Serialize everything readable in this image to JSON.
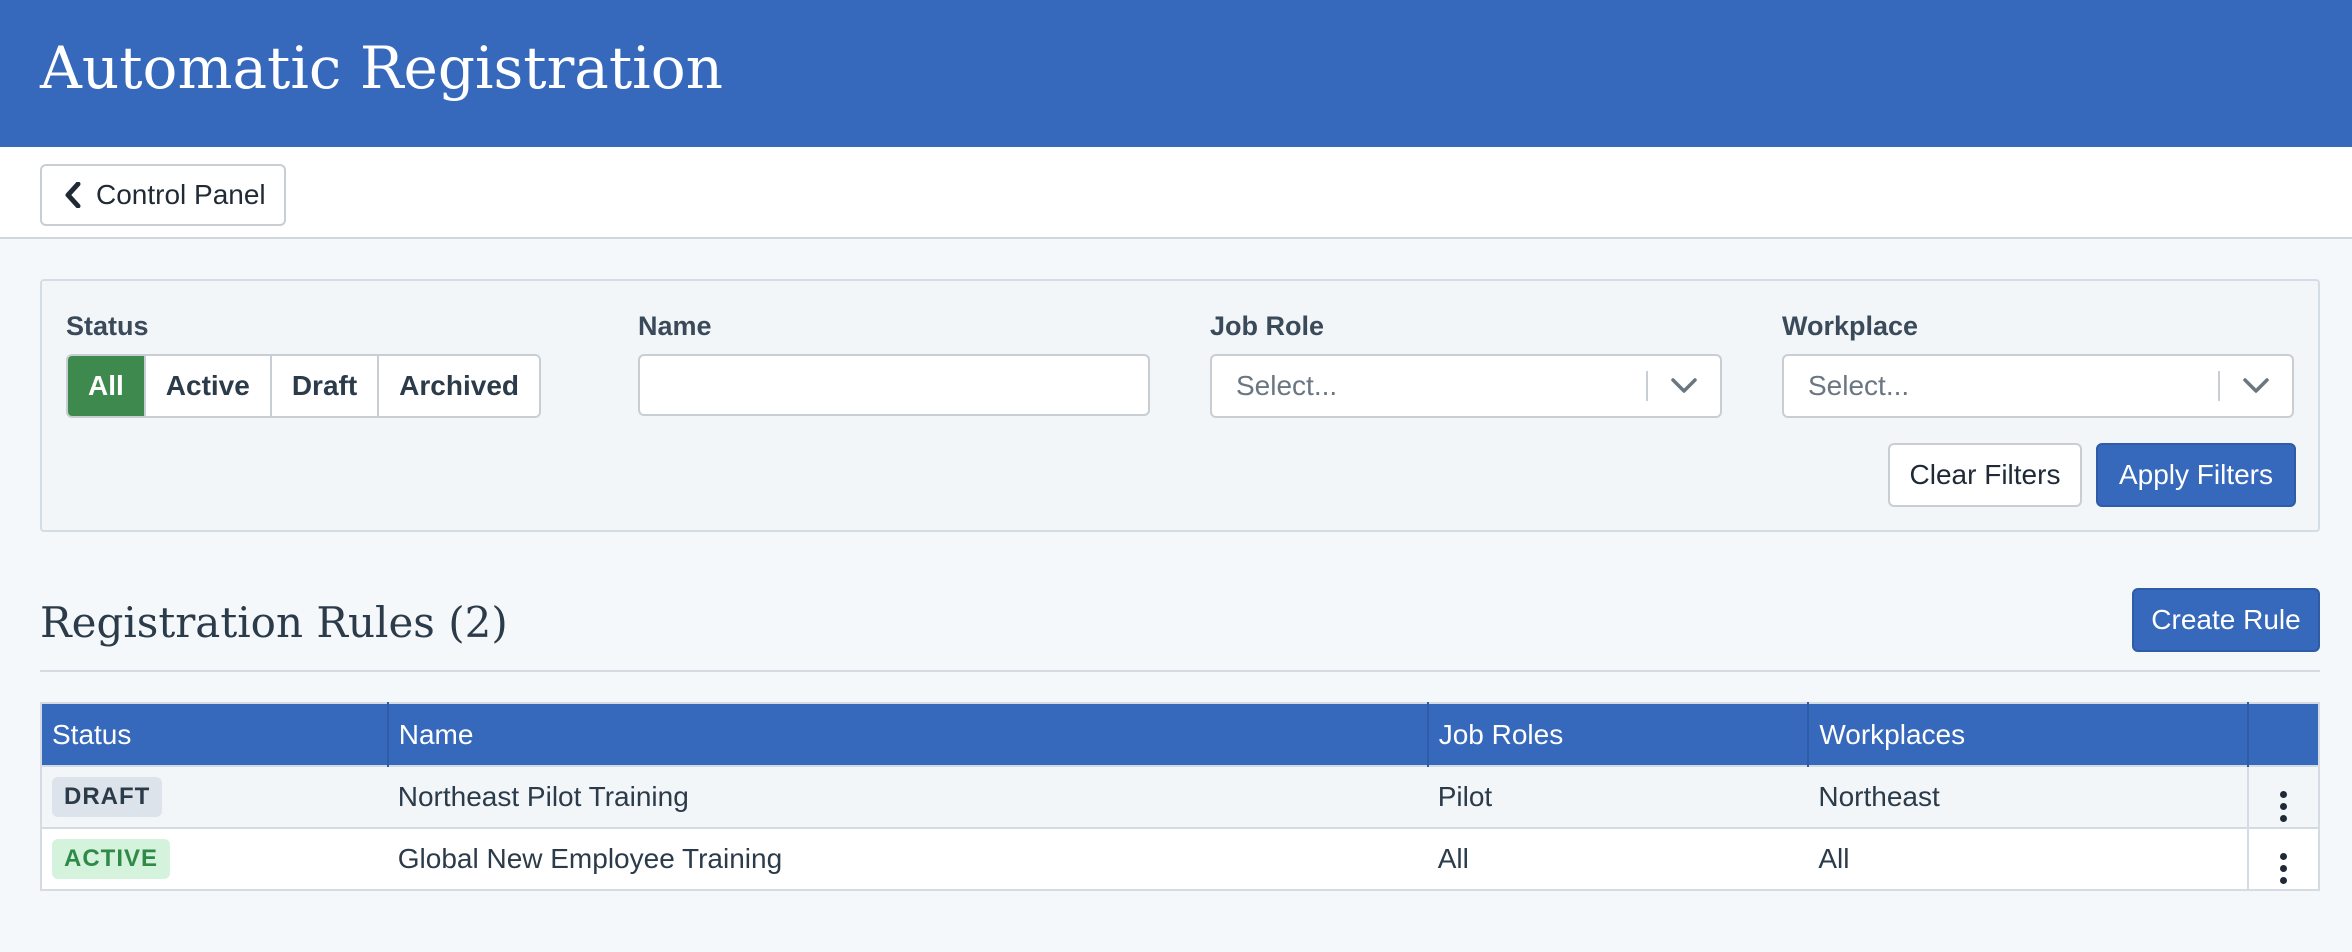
{
  "header": {
    "title": "Automatic Registration"
  },
  "topbar": {
    "back_label": "Control Panel"
  },
  "filters": {
    "status_label": "Status",
    "status_options": [
      "All",
      "Active",
      "Draft",
      "Archived"
    ],
    "status_selected": "All",
    "name_label": "Name",
    "name_value": "",
    "job_role_label": "Job Role",
    "job_role_placeholder": "Select...",
    "workplace_label": "Workplace",
    "workplace_placeholder": "Select...",
    "clear_label": "Clear Filters",
    "apply_label": "Apply Filters"
  },
  "rules": {
    "title": "Registration Rules (2)",
    "create_label": "Create Rule",
    "columns": [
      "Status",
      "Name",
      "Job Roles",
      "Workplaces",
      ""
    ],
    "rows": [
      {
        "status": "DRAFT",
        "status_kind": "draft",
        "name": "Northeast Pilot Training",
        "job_roles": "Pilot",
        "workplaces": "Northeast"
      },
      {
        "status": "ACTIVE",
        "status_kind": "active",
        "name": "Global New Employee Training",
        "job_roles": "All",
        "workplaces": "All"
      }
    ]
  },
  "colors": {
    "brand_blue": "#3669bb",
    "active_green": "#3e8a4e",
    "badge_active_bg": "#d5f2dd",
    "badge_draft_bg": "#dde3ea"
  }
}
